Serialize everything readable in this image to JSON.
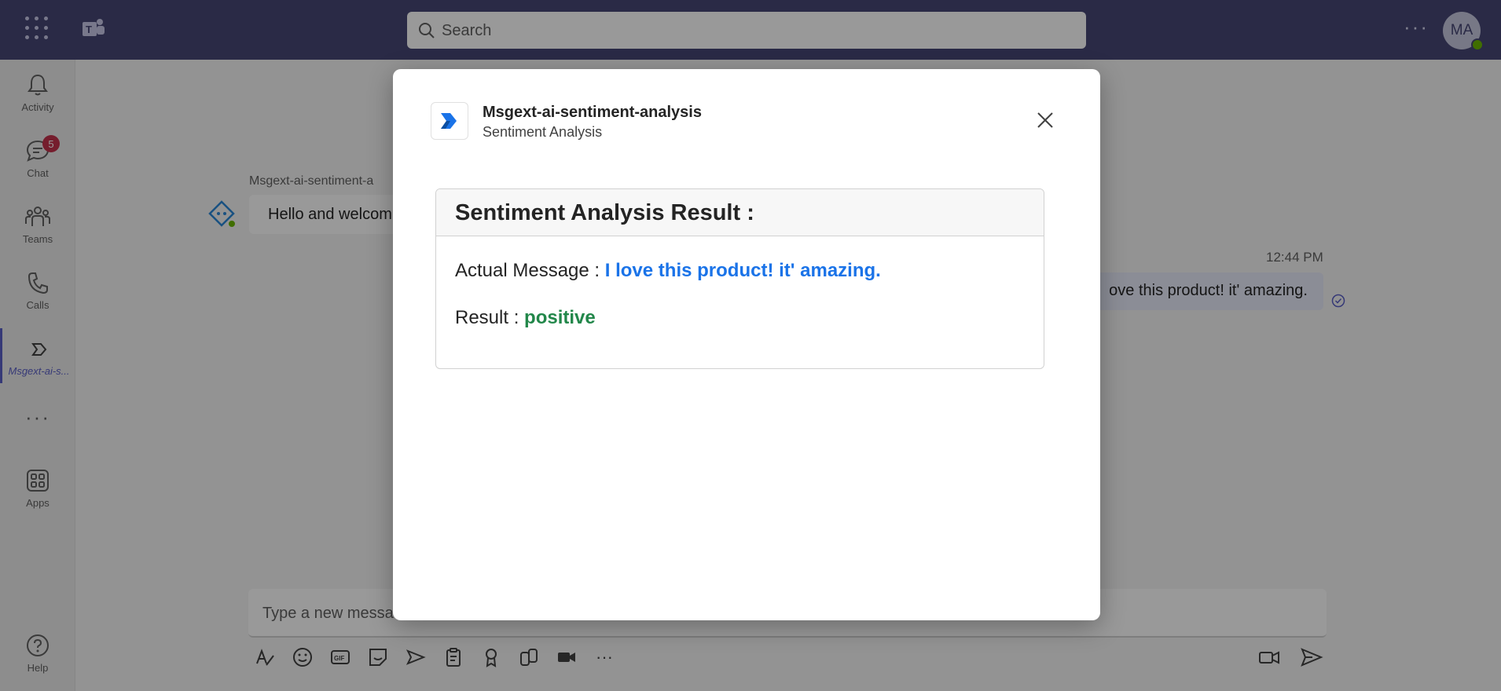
{
  "topbar": {
    "search_placeholder": "Search",
    "avatar_initials": "MA"
  },
  "rail": {
    "items": [
      {
        "label": "Activity"
      },
      {
        "label": "Chat",
        "badge": "5"
      },
      {
        "label": "Teams"
      },
      {
        "label": "Calls"
      },
      {
        "label": "Msgext-ai-s..."
      },
      {
        "label": "Apps"
      },
      {
        "label": "Help"
      }
    ]
  },
  "chat": {
    "bot_name": "Msgext-ai-sentiment-a",
    "bot_message": "Hello and welcom",
    "sent_time": "12:44 PM",
    "sent_message": "ove this product! it' amazing.",
    "compose_placeholder": "Type a new messa"
  },
  "dialog": {
    "app_title": "Msgext-ai-sentiment-analysis",
    "app_subtitle": "Sentiment Analysis",
    "card_title": "Sentiment Analysis Result :",
    "message_label": "Actual Message : ",
    "message_value": "I love this product! it' amazing.",
    "result_label": "Result : ",
    "result_value": "positive"
  },
  "colors": {
    "topbar": "#464775",
    "accent": "#5b5fc7",
    "message_value": "#1a73e8",
    "result_positive": "#22874a",
    "badge": "#c4314b"
  }
}
